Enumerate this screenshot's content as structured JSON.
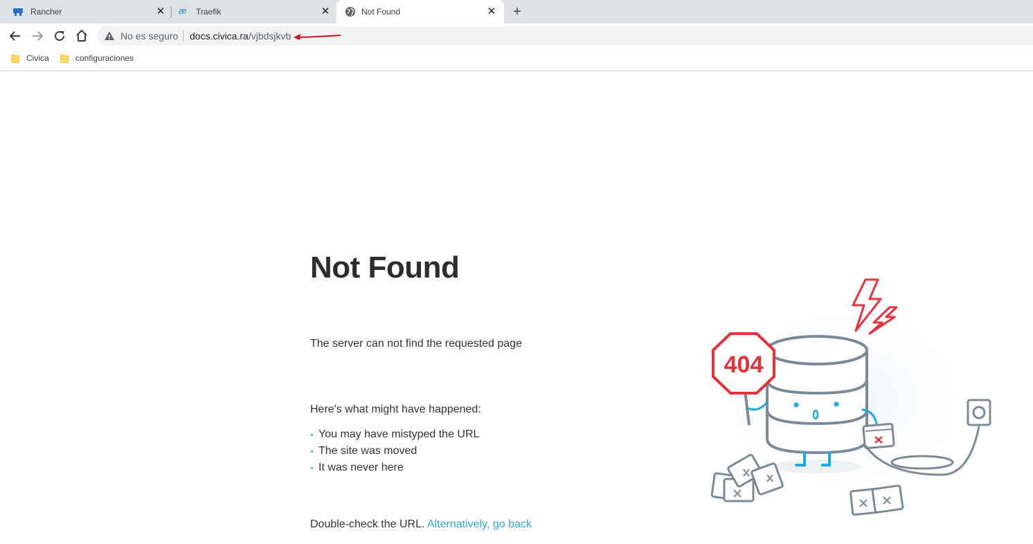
{
  "tabs": [
    {
      "title": "Rancher",
      "icon": "rancher-icon",
      "active": false
    },
    {
      "title": "Traefik",
      "icon": "traefik-icon",
      "active": false
    },
    {
      "title": "Not Found",
      "icon": "globe-icon",
      "active": true
    }
  ],
  "toolbar": {
    "security_label": "No es seguro",
    "url_host": "docs.civica.ra",
    "url_path": "/vjbdsjkvb"
  },
  "bookmarks": [
    {
      "label": "Civica",
      "icon": "folder-icon"
    },
    {
      "label": "configuraciones",
      "icon": "folder-icon"
    }
  ],
  "page": {
    "title": "Not Found",
    "description": "The server can not find the requested page",
    "happened_heading": "Here's what might have happened:",
    "reasons": [
      "You may have mistyped the URL",
      "The site was moved",
      "It was never here"
    ],
    "footer_text": "Double-check the URL.",
    "footer_link": "Alternatively, go back"
  },
  "illustration": {
    "sign_text": "404",
    "colors": {
      "accent_red": "#e8303a",
      "stroke_gray": "#7a8a99",
      "accent_blue": "#1ca8e0"
    }
  }
}
